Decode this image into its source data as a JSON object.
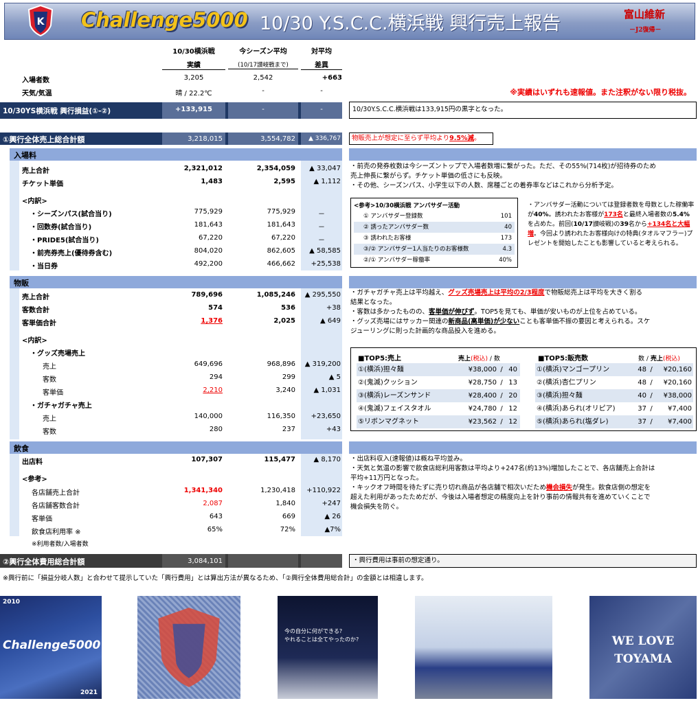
{
  "header": {
    "brand": "Challenge5000",
    "title": "10/30 Y.S.C.C.横浜戦 興行売上報告",
    "slogan": "富山維新",
    "sub_slogan": "－J2復帰－"
  },
  "columns": {
    "c1a": "10/30横浜戦",
    "c1b": "実績",
    "c2a": "今シーズン平均",
    "c2b": "(10/17讃岐戦まで)",
    "c3a": "対平均",
    "c3b": "差異"
  },
  "top": [
    {
      "label": "入場者数",
      "v1": "3,205",
      "v2": "2,542",
      "v3": "+663"
    },
    {
      "label": "天気/気温",
      "v1": "晴 / 22.2℃",
      "v2": "-",
      "v3": "-"
    }
  ],
  "disclaimer": "※実績はいずれも速報値。また注釈がない限り税抜。",
  "profit": {
    "label": "10/30YS横浜戦 興行損益(①-②)",
    "v1": "+133,915",
    "v2": "-",
    "v3": "-",
    "note": "10/30Y.S.C.C.横浜戦は133,915円の黒字となった。"
  },
  "total_sales": {
    "label": "①興行全体売上総合計額",
    "v1": "3,218,015",
    "v2": "3,554,782",
    "v3": "▲ 336,767",
    "note_a": "物販売上が想定に至らず平均より",
    "note_b": "9.5%減",
    "note_c": "。"
  },
  "ticket": {
    "title": "入場料",
    "rows": [
      {
        "label": "売上合計",
        "v1": "2,321,012",
        "v2": "2,354,059",
        "v3": "▲ 33,047"
      },
      {
        "label": "チケット単価",
        "v1": "1,483",
        "v2": "2,595",
        "v3": "▲ 1,112"
      },
      {
        "label": "<内訳>",
        "v1": "",
        "v2": "",
        "v3": ""
      },
      {
        "label": "・シーズンパス(試合当り)",
        "v1": "775,929",
        "v2": "775,929",
        "v3": "－"
      },
      {
        "label": "・回数券(試合当り)",
        "v1": "181,643",
        "v2": "181,643",
        "v3": "－"
      },
      {
        "label": "・PRIDE5(試合当り)",
        "v1": "67,220",
        "v2": "67,220",
        "v3": "－"
      },
      {
        "label": "・前売券売上(優待券含む)",
        "v1": "804,020",
        "v2": "862,605",
        "v3": "▲ 58,585"
      },
      {
        "label": "・当日券",
        "v1": "492,200",
        "v2": "466,662",
        "v3": "+25,538"
      }
    ],
    "notes": [
      "・前売の発券枚数は今シーズントップで入場者数増に繋がった。ただ、その55%(714枚)が招待券のため",
      "売上伸長に繋がらず。チケット単価の低さにも反映。",
      "・その他、シーズンパス、小学生以下の人数、席種ごとの着券率などはこれから分析予定。"
    ],
    "amb_title": "<参考>10/30横浜戦 アンバサダー活動",
    "amb": [
      {
        "label": "① アンバサダー登録数",
        "value": "101"
      },
      {
        "label": "② 誘ったアンバサダー数",
        "value": "40"
      },
      {
        "label": "③ 誘われたお客様",
        "value": "173"
      },
      {
        "label": "③/② アンバサダー1人当たりのお客様数",
        "value": "4.3"
      },
      {
        "label": "②/① アンバサダー稼働率",
        "value": "40%"
      }
    ],
    "amb_note": [
      "・アンバサダー活動については登録者数を母数と",
      "した稼働率が",
      "40%",
      "。誘われたお客様が",
      "173名",
      "と最",
      "終入場者数の",
      "5.4%",
      "を占めた。前回(",
      "10/17",
      "讃岐戦)",
      "の",
      "39",
      "名から",
      "+134名と大幅増",
      "。今回より誘われたお",
      "客様向けの特典(タオルマフラー)プレゼントを開始",
      "したことも影響していると考えられる。"
    ]
  },
  "goods": {
    "title": "物販",
    "rows": [
      {
        "label": "売上合計",
        "v1": "789,696",
        "v2": "1,085,246",
        "v3": "▲ 295,550"
      },
      {
        "label": "客数合計",
        "v1": "574",
        "v2": "536",
        "v3": "+38"
      },
      {
        "label": "客単価合計",
        "v1": "1,376",
        "v2": "2,025",
        "v3": "▲ 649"
      },
      {
        "label": "<内訳>",
        "v1": "",
        "v2": "",
        "v3": ""
      },
      {
        "label": "・グッズ売場売上",
        "v1": "",
        "v2": "",
        "v3": ""
      },
      {
        "label": "売上",
        "v1": "649,696",
        "v2": "968,896",
        "v3": "▲ 319,200"
      },
      {
        "label": "客数",
        "v1": "294",
        "v2": "299",
        "v3": "▲ 5"
      },
      {
        "label": "客単価",
        "v1": "2,210",
        "v2": "3,240",
        "v3": "▲ 1,031"
      },
      {
        "label": "・ガチャガチャ売上",
        "v1": "",
        "v2": "",
        "v3": ""
      },
      {
        "label": "売上",
        "v1": "140,000",
        "v2": "116,350",
        "v3": "+23,650"
      },
      {
        "label": "客数",
        "v1": "280",
        "v2": "237",
        "v3": "+43"
      }
    ],
    "notes": {
      "l1a": "・ガチャガチャ売上は平均越え、",
      "l1b": "グッズ売場売上は平均の2/3程度",
      "l1c": "で物販総売上は平均を大きく割る",
      "l2": "結果となった。",
      "l3a": "・客数は多かったものの、",
      "l3b": "客単価が伸びず",
      "l3c": "。TOP5を見ても、単価が安いものが上位を占めている。",
      "l4a": "・グッズ売場にはサッカー関連の",
      "l4b": "新商品(高単価)が少ない",
      "l4c": "ことも客単価不振の要因と考えられる。スケ",
      "l5": "ジューリングに則った計画的な商品投入を進める。"
    },
    "top5_sales": {
      "title": "■TOP5:売上",
      "h1": "売上",
      "h2": "(税込)",
      "h3": "/",
      "h4": "数",
      "items": [
        {
          "name": "①(横浜)担々麺",
          "amount": "¥38,000",
          "sep": "/",
          "qty": "40"
        },
        {
          "name": "②(鬼滅)クッション",
          "amount": "¥28,750",
          "sep": "/",
          "qty": "13"
        },
        {
          "name": "③(横浜)レーズンサンド",
          "amount": "¥28,400",
          "sep": "/",
          "qty": "20"
        },
        {
          "name": "④(鬼滅)フェイスタオル",
          "amount": "¥24,780",
          "sep": "/",
          "qty": "12"
        },
        {
          "name": "⑤リボンマグネット",
          "amount": "¥23,562",
          "sep": "/",
          "qty": "12"
        }
      ]
    },
    "top5_qty": {
      "title": "■TOP5:販売数",
      "h1": "数",
      "h2": "/",
      "h3": "売上",
      "h4": "(税込)",
      "items": [
        {
          "name": "①(横浜)マンゴープリン",
          "qty": "48",
          "sep": "/",
          "amount": "¥20,160"
        },
        {
          "name": "②(横浜)杏仁プリン",
          "qty": "48",
          "sep": "/",
          "amount": "¥20,160"
        },
        {
          "name": "③(横浜)担々麺",
          "qty": "40",
          "sep": "/",
          "amount": "¥38,000"
        },
        {
          "name": "④(横浜)あられ(オリピア)",
          "qty": "37",
          "sep": "/",
          "amount": "¥7,400"
        },
        {
          "name": "⑤(横浜)あられ(塩ダレ)",
          "qty": "37",
          "sep": "/",
          "amount": "¥7,400"
        }
      ]
    }
  },
  "food": {
    "title": "飲食",
    "rows": [
      {
        "label": "出店料",
        "v1": "107,307",
        "v2": "115,477",
        "v3": "▲ 8,170"
      },
      {
        "label": "<参考>",
        "v1": "",
        "v2": "",
        "v3": ""
      },
      {
        "label": "各店舗売上合計",
        "v1": "1,341,340",
        "v2": "1,230,418",
        "v3": "+110,922"
      },
      {
        "label": "各店舗客数合計",
        "v1": "2,087",
        "v2": "1,840",
        "v3": "+247"
      },
      {
        "label": "客単価",
        "v1": "643",
        "v2": "669",
        "v3": "▲ 26"
      },
      {
        "label": "飲食店利用率 ※",
        "v1": "65%",
        "v2": "72%",
        "v3": "▲7%"
      }
    ],
    "footnote": "※利用者数/入場者数",
    "notes": {
      "l1": "・出店料収入(速報値)は概ね平均並み。",
      "l2": "・天気と気温の影響で飲食店総利用客数は平均より+247名(約13%)増加したことで、各店舗売上合計は",
      "l3": "平均+11万円となった。",
      "l4a": "・キックオフ時間を待たずに売り切れ商品が各店舗で相次いだため",
      "l4b": "機会損失",
      "l4c": "が発生。飲食店側の想定を",
      "l5": "超えた利用があったためだが、今後は入場者想定の精度向上を計り事前の情報共有を進めていくことで",
      "l6": "機会損失を防ぐ。"
    }
  },
  "total_cost": {
    "label": "②興行全体費用総合計額",
    "v1": "3,084,101",
    "v2": "",
    "v3": "",
    "note": "・興行費用は事前の想定通り。"
  },
  "footnote": "※興行前に「損益分岐人数」と合わせて提示していた「興行費用」とは算出方法が異なるため、「②興行全体費用総合計」の金額とは相違します。",
  "photos": {
    "p1_year_top": "2010",
    "p1_brand": "Challenge5000",
    "p1_year_bottom": "2021",
    "p3_text1": "今の自分に何ができる?",
    "p3_text2": "やれることは全てやったのか?",
    "p5_l1": "WE LOVE",
    "p5_l2": "TOYAMA"
  },
  "colors": {
    "navy": "#1f3864",
    "section": "#8ea9db",
    "light": "#dde8f6",
    "red": "#e00000",
    "gold": "#f3c21a"
  }
}
